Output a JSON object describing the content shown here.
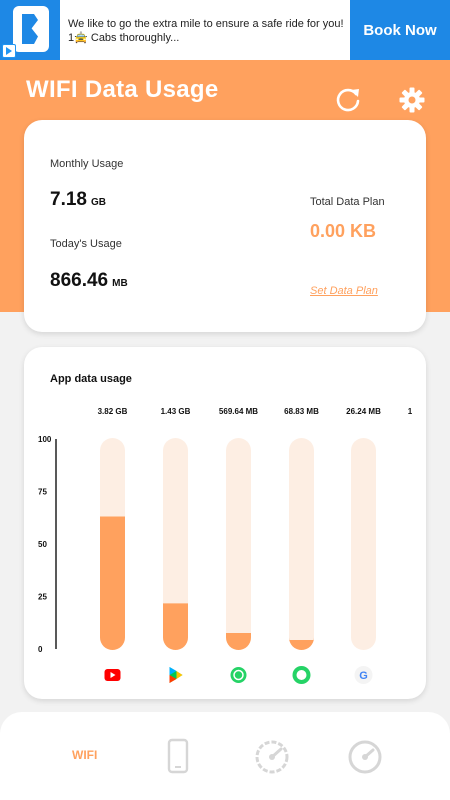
{
  "ad": {
    "text": "We like to go the extra mile to ensure a safe ride for you! 1🚖 Cabs thoroughly...",
    "button": "Book Now"
  },
  "header": {
    "title": "WIFI Data Usage"
  },
  "usage": {
    "monthly_label": "Monthly Usage",
    "monthly_value": "7.18",
    "monthly_unit": "GB",
    "today_label": "Today's Usage",
    "today_value": "866.46",
    "today_unit": "MB",
    "total_label": "Total Data Plan",
    "total_value": "0.00 KB",
    "set_plan": "Set Data Plan"
  },
  "apps": {
    "title": "App data usage"
  },
  "chart_data": {
    "type": "bar",
    "categories": [
      "youtube-icon",
      "play-store-icon",
      "whatsapp-icon",
      "whatsapp-business-icon",
      "google-icon"
    ],
    "value_labels": [
      "3.82 GB",
      "1.43 GB",
      "569.64 MB",
      "68.83 MB",
      "26.24 MB",
      "1"
    ],
    "values": [
      63,
      22,
      8,
      1,
      0
    ],
    "yticks": [
      "100",
      "75",
      "50",
      "25",
      "0"
    ],
    "ylim": [
      0,
      100
    ],
    "colors": {
      "fill": "#ffa15e",
      "track": "#fdeee3"
    }
  },
  "nav": {
    "wifi_label": "WIFI"
  },
  "colors": {
    "accent": "#ffa15e",
    "ad_blue": "#1e88e5"
  }
}
